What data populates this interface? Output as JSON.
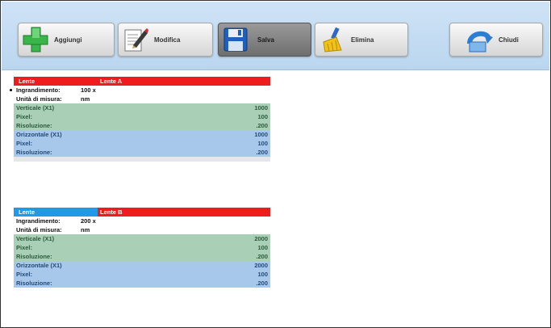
{
  "toolbar": {
    "add_label": "Aggiungi",
    "edit_label": "Modifica",
    "save_label": "Salva",
    "clear_label": "Elimina",
    "close_label": "Chiudi"
  },
  "panels": [
    {
      "header_key": "Lente",
      "header_value": "Lente A",
      "magnification_label": "Ingrandimento:",
      "magnification_value": "100 x",
      "unit_label": "Unità di misura:",
      "unit_value": "nm",
      "vertical_label": "Verticale (X1)",
      "vertical_value": "1000",
      "v_pixel_label": "Pixel:",
      "v_pixel_value": "100",
      "v_resolution_label": "Risoluzione:",
      "v_resolution_value": ".200",
      "horizontal_label": "Orizzontale (X1)",
      "horizontal_value": "1000",
      "h_pixel_label": "Pixel:",
      "h_pixel_value": "100",
      "h_resolution_label": "Risoluzione:",
      "h_resolution_value": ".200",
      "header_color": "#ee1c1c"
    },
    {
      "header_key": "Lente",
      "header_value": "Lente B",
      "magnification_label": "Ingrandimento:",
      "magnification_value": "200 x",
      "unit_label": "Unità di misura:",
      "unit_value": "nm",
      "vertical_label": "Verticale (X1)",
      "vertical_value": "2000",
      "v_pixel_label": "Pixel:",
      "v_pixel_value": "100",
      "v_resolution_label": "Risoluzione:",
      "v_resolution_value": ".200",
      "horizontal_label": "Orizzontale (X1)",
      "horizontal_value": "2000",
      "h_pixel_label": "Pixel:",
      "h_pixel_value": "100",
      "h_resolution_label": "Risoluzione:",
      "h_resolution_value": ".200",
      "header_color": "#1f9be6"
    }
  ]
}
